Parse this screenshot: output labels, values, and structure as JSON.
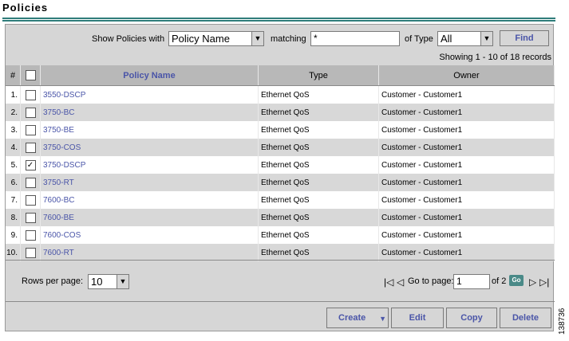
{
  "page_title": "Policies",
  "filter": {
    "show_label": "Show Policies with",
    "field_value": "Policy Name",
    "matching_label": "matching",
    "matching_value": "*",
    "type_label": "of Type",
    "type_value": "All",
    "find_label": "Find"
  },
  "showing_text": "Showing 1 - 10 of 18 records",
  "columns": {
    "num": "#",
    "name": "Policy Name",
    "type": "Type",
    "owner": "Owner"
  },
  "rows": [
    {
      "num": "1.",
      "name": "3550-DSCP",
      "type": "Ethernet QoS",
      "owner": "Customer - Customer1",
      "checked": false
    },
    {
      "num": "2.",
      "name": "3750-BC",
      "type": "Ethernet QoS",
      "owner": "Customer - Customer1",
      "checked": false
    },
    {
      "num": "3.",
      "name": "3750-BE",
      "type": "Ethernet QoS",
      "owner": "Customer - Customer1",
      "checked": false
    },
    {
      "num": "4.",
      "name": "3750-COS",
      "type": "Ethernet QoS",
      "owner": "Customer - Customer1",
      "checked": false
    },
    {
      "num": "5.",
      "name": "3750-DSCP",
      "type": "Ethernet QoS",
      "owner": "Customer - Customer1",
      "checked": true
    },
    {
      "num": "6.",
      "name": "3750-RT",
      "type": "Ethernet QoS",
      "owner": "Customer - Customer1",
      "checked": false
    },
    {
      "num": "7.",
      "name": "7600-BC",
      "type": "Ethernet QoS",
      "owner": "Customer - Customer1",
      "checked": false
    },
    {
      "num": "8.",
      "name": "7600-BE",
      "type": "Ethernet QoS",
      "owner": "Customer - Customer1",
      "checked": false
    },
    {
      "num": "9.",
      "name": "7600-COS",
      "type": "Ethernet QoS",
      "owner": "Customer - Customer1",
      "checked": false
    },
    {
      "num": "10.",
      "name": "7600-RT",
      "type": "Ethernet QoS",
      "owner": "Customer - Customer1",
      "checked": false
    }
  ],
  "pager": {
    "rows_label": "Rows per page:",
    "rows_value": "10",
    "goto_label": "Go to page:",
    "page_value": "1",
    "of_label": "of 2",
    "go_label": "Go"
  },
  "actions": {
    "create": "Create",
    "edit": "Edit",
    "copy": "Copy",
    "delete": "Delete"
  },
  "figure_id": "138736"
}
